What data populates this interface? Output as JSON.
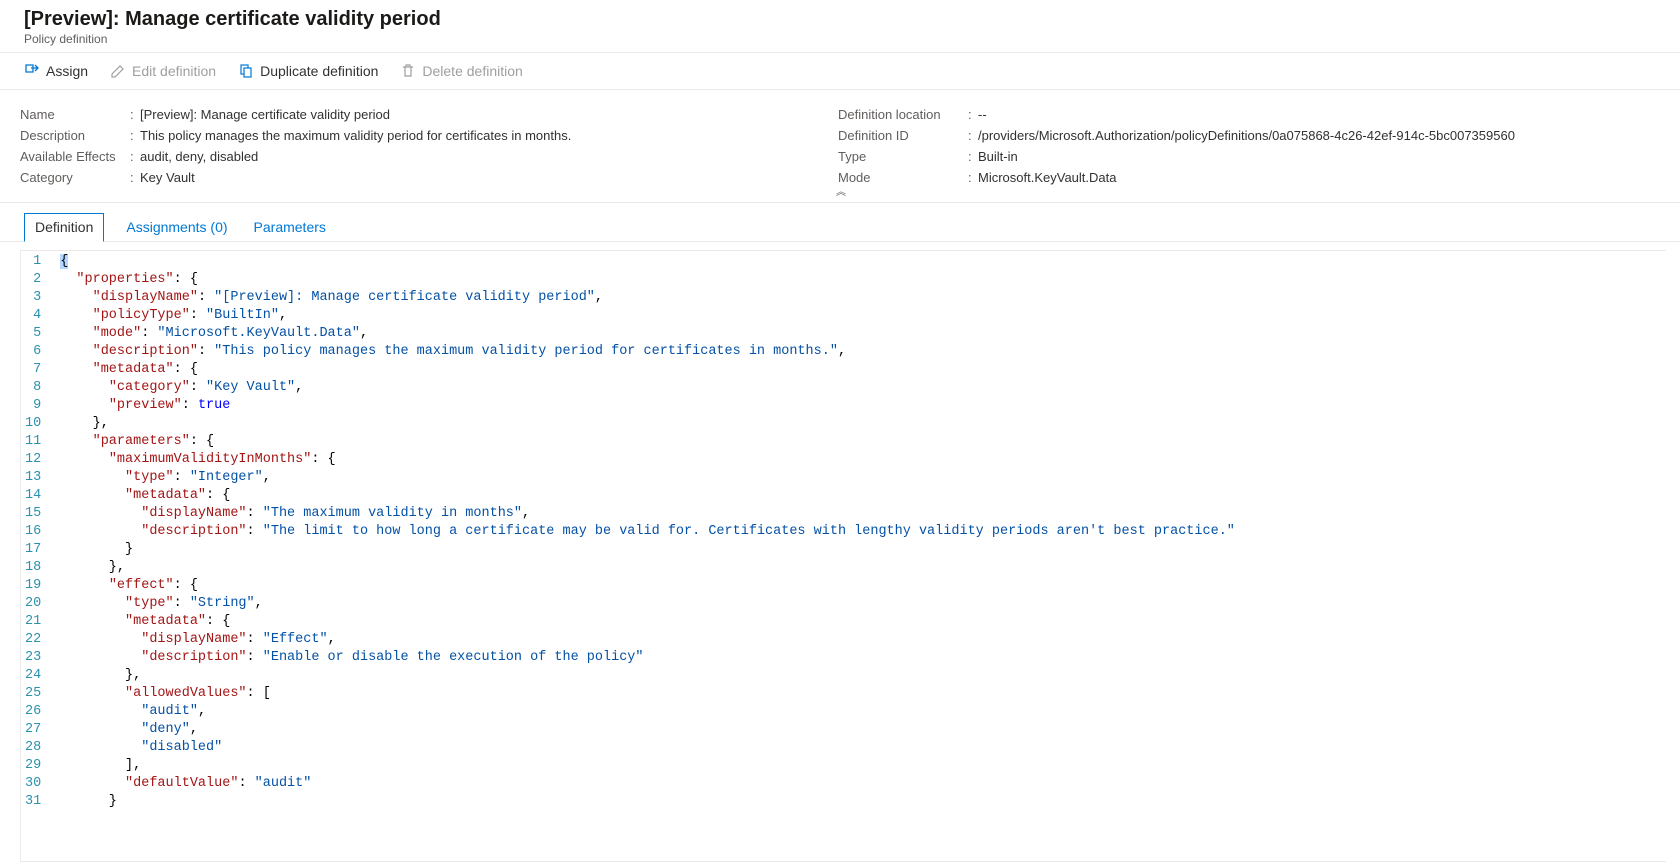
{
  "header": {
    "title": "[Preview]: Manage certificate validity period",
    "subtitle": "Policy definition"
  },
  "toolbar": {
    "assign": "Assign",
    "edit": "Edit definition",
    "duplicate": "Duplicate definition",
    "delete": "Delete definition"
  },
  "essentials": {
    "left": {
      "name_label": "Name",
      "name_value": "[Preview]: Manage certificate validity period",
      "desc_label": "Description",
      "desc_value": "This policy manages the maximum validity period for certificates in months.",
      "effects_label": "Available Effects",
      "effects_value": "audit, deny, disabled",
      "cat_label": "Category",
      "cat_value": "Key Vault"
    },
    "right": {
      "loc_label": "Definition location",
      "loc_value": "--",
      "id_label": "Definition ID",
      "id_value": "/providers/Microsoft.Authorization/policyDefinitions/0a075868-4c26-42ef-914c-5bc007359560",
      "type_label": "Type",
      "type_value": "Built-in",
      "mode_label": "Mode",
      "mode_value": "Microsoft.KeyVault.Data"
    }
  },
  "tabs": {
    "definition": "Definition",
    "assignments": "Assignments (0)",
    "parameters": "Parameters"
  },
  "code": {
    "lines": 31,
    "source": {
      "properties": {
        "displayName": "[Preview]: Manage certificate validity period",
        "policyType": "BuiltIn",
        "mode": "Microsoft.KeyVault.Data",
        "description": "This policy manages the maximum validity period for certificates in months.",
        "metadata": {
          "category": "Key Vault",
          "preview": true
        },
        "parameters": {
          "maximumValidityInMonths": {
            "type": "Integer",
            "metadata": {
              "displayName": "The maximum validity in months",
              "description": "The limit to how long a certificate may be valid for. Certificates with lengthy validity periods aren't best practice."
            }
          },
          "effect": {
            "type": "String",
            "metadata": {
              "displayName": "Effect",
              "description": "Enable or disable the execution of the policy"
            },
            "allowedValues": [
              "audit",
              "deny",
              "disabled"
            ],
            "defaultValue": "audit"
          }
        }
      }
    }
  }
}
